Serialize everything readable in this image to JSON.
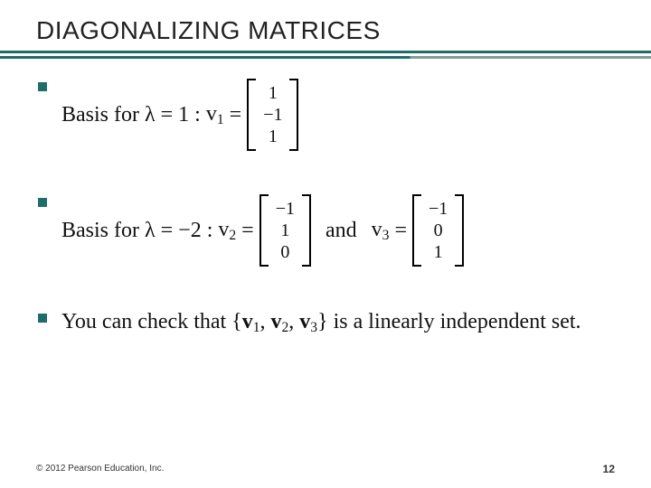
{
  "title": "DIAGONALIZING MATRICES",
  "bullets": {
    "b1": {
      "lead": "Basis for",
      "lambda": "λ = 1 :",
      "vlabel": "v",
      "vsub": "1",
      "eq": "=",
      "vec": [
        "1",
        "−1",
        "1"
      ]
    },
    "b2": {
      "lead": "Basis for",
      "lambda": "λ = −2 :",
      "v2label": "v",
      "v2sub": "2",
      "eq1": "=",
      "vecA": [
        "−1",
        "1",
        "0"
      ],
      "and": "and",
      "v3label": "v",
      "v3sub": "3",
      "eq2": "=",
      "vecB": [
        "−1",
        "0",
        "1"
      ]
    },
    "b3": {
      "pre": "You can check that {",
      "v1": "v",
      "s1": "1",
      "c1": ", ",
      "v2": "v",
      "s2": "2",
      "c2": ", ",
      "v3": "v",
      "s3": "3",
      "post": "} is a linearly independent set."
    }
  },
  "footer": "© 2012 Pearson Education, Inc.",
  "pagenum": "12"
}
